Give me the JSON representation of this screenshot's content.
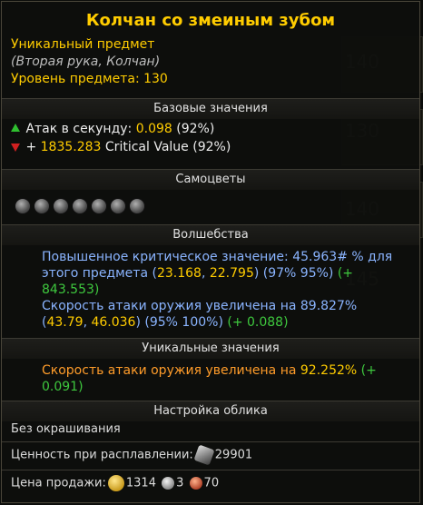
{
  "background": {
    "numbers": [
      "140",
      "130",
      "140",
      "145",
      "145"
    ]
  },
  "item": {
    "name": "Колчан со змеиным зубом",
    "rarity": "Уникальный предмет",
    "slot": "(Вторая рука, Колчан)",
    "level": "Уровень предмета: 130"
  },
  "sections": {
    "base": "Базовые значения",
    "gems": "Самоцветы",
    "magic": "Волшебства",
    "unique": "Уникальные значения",
    "appearance": "Настройка облика"
  },
  "base_stats": [
    {
      "label": "Атак в секунду:",
      "value": "0.098",
      "pct": "(92%)",
      "trend": "up"
    },
    {
      "prefix": "+",
      "value": "1835.283",
      "label": "Critical Value",
      "pct": "(92%)",
      "trend": "down"
    }
  ],
  "gem_count": 7,
  "magic": [
    {
      "text": "Повышенное критическое значение: 45.963# % для этого предмета",
      "range_open": "(",
      "range_a": "23.168",
      "range_sep": ", ",
      "range_b": "22.795",
      "range_close": ")",
      "pct": "(97% 95%)",
      "bonus": "(+ 843.553)"
    },
    {
      "text": "Скорость атаки оружия увеличена на 89.827%",
      "range_open": "(",
      "range_a": "43.79",
      "range_sep": ", ",
      "range_b": "46.036",
      "range_close": ")",
      "pct": "(95% 100%)",
      "bonus": "(+ 0.088)"
    }
  ],
  "unique": {
    "text": "Скорость атаки оружия увеличена на",
    "value": "92.252%",
    "bonus": "(+ 0.091)"
  },
  "appearance": {
    "dye": "Без окрашивания"
  },
  "salvage": {
    "label": "Ценность при расплавлении:",
    "value": "29901"
  },
  "sell": {
    "label": "Цена продажи:",
    "gold": "1314",
    "silver": "3",
    "copper": "70"
  },
  "colors": {
    "title": "#ffcc00",
    "magic": "#8ab4ff",
    "legendary": "#ff9c2a",
    "green": "#3ec83e"
  }
}
